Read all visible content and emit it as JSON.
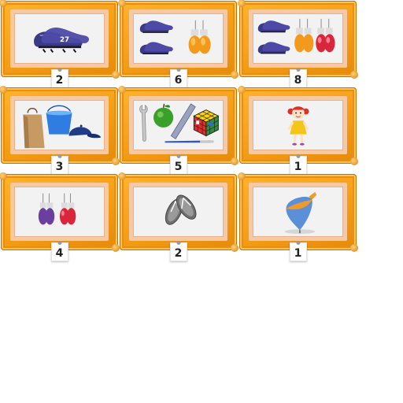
{
  "cards": [
    {
      "count": "2",
      "items": [
        "football-boots"
      ]
    },
    {
      "count": "6",
      "items": [
        "football-boots",
        "football-boots",
        "boxing-gloves"
      ]
    },
    {
      "count": "8",
      "items": [
        "football-boots",
        "football-boots",
        "boxing-gloves",
        "boxing-gloves"
      ]
    },
    {
      "count": "3",
      "items": [
        "paper-bag",
        "bucket",
        "cap"
      ]
    },
    {
      "count": "5",
      "items": [
        "wrench",
        "apple",
        "ruler",
        "rubiks-cube",
        "pen"
      ]
    },
    {
      "count": "1",
      "items": [
        "rag-doll"
      ]
    },
    {
      "count": "4",
      "items": [
        "boxing-gloves",
        "boxing-gloves"
      ]
    },
    {
      "count": "2",
      "items": [
        "flip-flops"
      ]
    },
    {
      "count": "1",
      "items": [
        "spinning-top"
      ]
    }
  ],
  "colors": {
    "frame": "#f7a21a",
    "mat": "#f6c9a4",
    "canvas": "#f3f2f2",
    "boot": "#3b3a86",
    "glove_orange": "#f39a1d",
    "glove_red": "#d9263a",
    "glove_purple": "#6a3fa0"
  }
}
